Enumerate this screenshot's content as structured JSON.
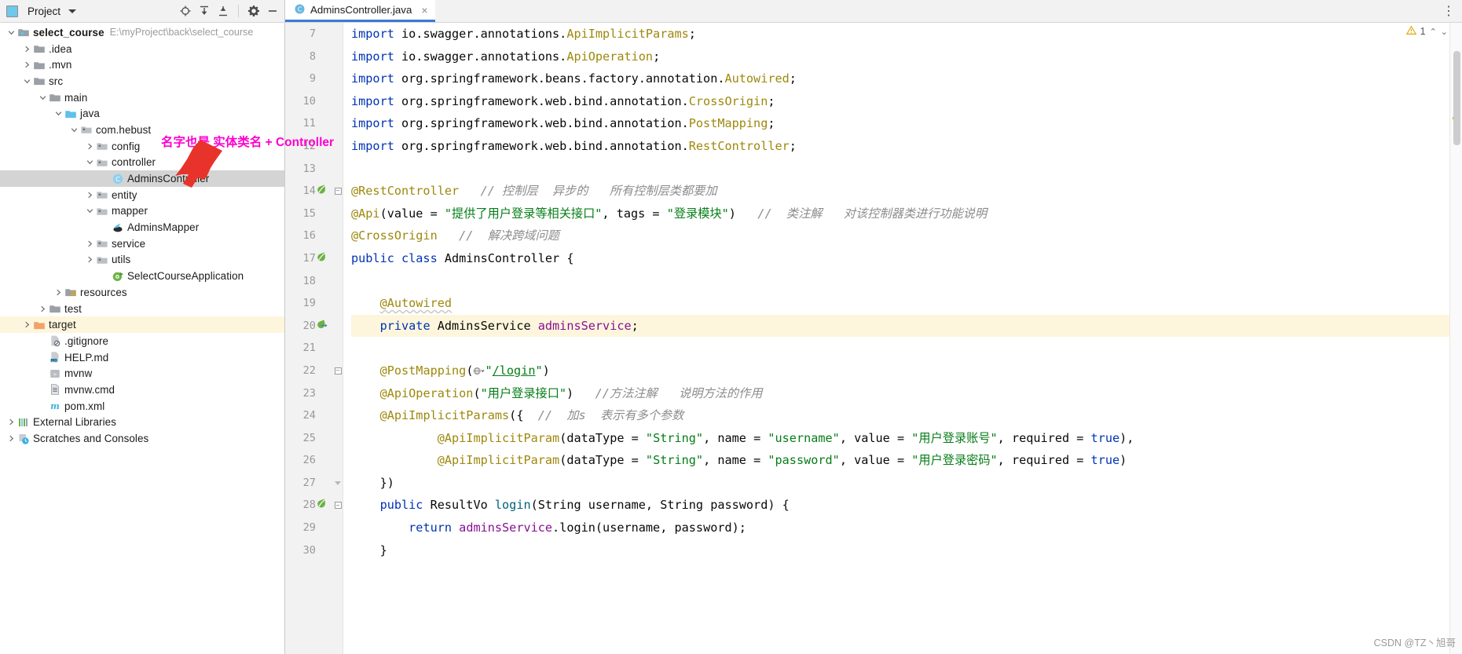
{
  "project_panel": {
    "toolbar": {
      "title": "Project",
      "icons": [
        "locate-icon",
        "expand-all-icon",
        "collapse-all-icon",
        "settings-gear-icon",
        "hide-minimize-icon"
      ]
    },
    "tree": [
      {
        "indent": 0,
        "arrow": "down",
        "icon": "module-folder-icon",
        "label": "select_course",
        "bold": true,
        "path": "E:\\myProject\\back\\select_course",
        "state": "normal"
      },
      {
        "indent": 1,
        "arrow": "right",
        "icon": "folder-icon",
        "label": ".idea",
        "state": "normal"
      },
      {
        "indent": 1,
        "arrow": "right",
        "icon": "folder-icon",
        "label": ".mvn",
        "state": "normal"
      },
      {
        "indent": 1,
        "arrow": "down",
        "icon": "folder-icon",
        "label": "src",
        "state": "normal"
      },
      {
        "indent": 2,
        "arrow": "down",
        "icon": "folder-icon",
        "label": "main",
        "state": "normal"
      },
      {
        "indent": 3,
        "arrow": "down",
        "icon": "source-folder-icon",
        "label": "java",
        "state": "normal"
      },
      {
        "indent": 4,
        "arrow": "down",
        "icon": "package-icon",
        "label": "com.hebust",
        "state": "normal"
      },
      {
        "indent": 5,
        "arrow": "right",
        "icon": "package-icon",
        "label": "config",
        "state": "normal"
      },
      {
        "indent": 5,
        "arrow": "down",
        "icon": "package-icon",
        "label": "controller",
        "state": "normal"
      },
      {
        "indent": 6,
        "arrow": "none",
        "icon": "java-class-icon",
        "label": "AdminsController",
        "state": "selected"
      },
      {
        "indent": 5,
        "arrow": "right",
        "icon": "package-icon",
        "label": "entity",
        "state": "normal"
      },
      {
        "indent": 5,
        "arrow": "down",
        "icon": "package-icon",
        "label": "mapper",
        "state": "normal"
      },
      {
        "indent": 6,
        "arrow": "none",
        "icon": "mybatis-mapper-icon",
        "label": "AdminsMapper",
        "state": "normal"
      },
      {
        "indent": 5,
        "arrow": "right",
        "icon": "package-icon",
        "label": "service",
        "state": "normal"
      },
      {
        "indent": 5,
        "arrow": "right",
        "icon": "package-icon",
        "label": "utils",
        "state": "normal"
      },
      {
        "indent": 6,
        "arrow": "none",
        "icon": "spring-boot-app-icon",
        "label": "SelectCourseApplication",
        "state": "normal"
      },
      {
        "indent": 3,
        "arrow": "right",
        "icon": "resources-folder-icon",
        "label": "resources",
        "state": "normal"
      },
      {
        "indent": 2,
        "arrow": "right",
        "icon": "folder-icon",
        "label": "test",
        "state": "normal"
      },
      {
        "indent": 1,
        "arrow": "right",
        "icon": "excluded-folder-icon",
        "label": "target",
        "state": "highlight"
      },
      {
        "indent": 2,
        "arrow": "none",
        "icon": "gitignore-file-icon",
        "label": ".gitignore",
        "state": "normal"
      },
      {
        "indent": 2,
        "arrow": "none",
        "icon": "markdown-file-icon",
        "label": "HELP.md",
        "state": "normal"
      },
      {
        "indent": 2,
        "arrow": "none",
        "icon": "shell-script-icon",
        "label": "mvnw",
        "state": "normal"
      },
      {
        "indent": 2,
        "arrow": "none",
        "icon": "cmd-file-icon",
        "label": "mvnw.cmd",
        "state": "normal"
      },
      {
        "indent": 2,
        "arrow": "none",
        "icon": "maven-file-icon",
        "label": "pom.xml",
        "state": "normal"
      },
      {
        "indent": 0,
        "arrow": "right",
        "icon": "libraries-icon",
        "label": "External Libraries",
        "state": "normal"
      },
      {
        "indent": 0,
        "arrow": "right",
        "icon": "scratches-icon",
        "label": "Scratches and Consoles",
        "state": "normal"
      }
    ]
  },
  "editor": {
    "tab": {
      "label": "AdminsController.java",
      "icon": "java-class-icon",
      "close_icon": "close-icon"
    },
    "tab_menu_icon": "more-options-icon",
    "inspection": {
      "warning_count": "1",
      "warning_icon": "warning-triangle-icon",
      "up_icon": "chevron-up-icon",
      "down_icon": "chevron-down-icon"
    },
    "lines": [
      {
        "num": "7",
        "tokens": [
          {
            "t": "kw",
            "s": "import "
          },
          {
            "t": "plain",
            "s": "io.swagger.annotations."
          },
          {
            "t": "ann",
            "s": "ApiImplicitParams"
          },
          {
            "t": "plain",
            "s": ";"
          }
        ]
      },
      {
        "num": "8",
        "tokens": [
          {
            "t": "kw",
            "s": "import "
          },
          {
            "t": "plain",
            "s": "io.swagger.annotations."
          },
          {
            "t": "ann",
            "s": "ApiOperation"
          },
          {
            "t": "plain",
            "s": ";"
          }
        ]
      },
      {
        "num": "9",
        "tokens": [
          {
            "t": "kw",
            "s": "import "
          },
          {
            "t": "plain",
            "s": "org.springframework.beans.factory.annotation."
          },
          {
            "t": "ann",
            "s": "Autowired"
          },
          {
            "t": "plain",
            "s": ";"
          }
        ]
      },
      {
        "num": "10",
        "tokens": [
          {
            "t": "kw",
            "s": "import "
          },
          {
            "t": "plain",
            "s": "org.springframework.web.bind.annotation."
          },
          {
            "t": "ann",
            "s": "CrossOrigin"
          },
          {
            "t": "plain",
            "s": ";"
          }
        ]
      },
      {
        "num": "11",
        "tokens": [
          {
            "t": "kw",
            "s": "import "
          },
          {
            "t": "plain",
            "s": "org.springframework.web.bind.annotation."
          },
          {
            "t": "ann",
            "s": "PostMapping"
          },
          {
            "t": "plain",
            "s": ";"
          }
        ]
      },
      {
        "num": "12",
        "tokens": [
          {
            "t": "kw",
            "s": "import "
          },
          {
            "t": "plain",
            "s": "org.springframework.web.bind.annotation."
          },
          {
            "t": "ann",
            "s": "RestController"
          },
          {
            "t": "plain",
            "s": ";"
          }
        ]
      },
      {
        "num": "13",
        "tokens": []
      },
      {
        "num": "14",
        "tokens": [
          {
            "t": "ann",
            "s": "@RestController"
          },
          {
            "t": "cmt",
            "s": "   // 控制层  异步的   所有控制层类都要加"
          }
        ]
      },
      {
        "num": "15",
        "tokens": [
          {
            "t": "ann",
            "s": "@Api"
          },
          {
            "t": "plain",
            "s": "(value = "
          },
          {
            "t": "str",
            "s": "\"提供了用户登录等相关接口\""
          },
          {
            "t": "plain",
            "s": ", tags = "
          },
          {
            "t": "str",
            "s": "\"登录模块\""
          },
          {
            "t": "plain",
            "s": ")"
          },
          {
            "t": "cmt",
            "s": "   //  类注解   对该控制器类进行功能说明"
          }
        ]
      },
      {
        "num": "16",
        "tokens": [
          {
            "t": "ann",
            "s": "@CrossOrigin"
          },
          {
            "t": "cmt",
            "s": "   //  解决跨域问题"
          }
        ]
      },
      {
        "num": "17",
        "tokens": [
          {
            "t": "kw",
            "s": "public class "
          },
          {
            "t": "plain",
            "s": "AdminsController {"
          }
        ]
      },
      {
        "num": "18",
        "tokens": []
      },
      {
        "num": "19",
        "tokens": [
          {
            "t": "plain",
            "s": "    "
          },
          {
            "t": "ann wavy",
            "s": "@Autowired"
          }
        ]
      },
      {
        "num": "20",
        "tokens": [
          {
            "t": "plain",
            "s": "    "
          },
          {
            "t": "kw",
            "s": "private "
          },
          {
            "t": "plain",
            "s": "AdminsService "
          },
          {
            "t": "fld",
            "s": "adminsService"
          },
          {
            "t": "plain",
            "s": ";"
          }
        ]
      },
      {
        "num": "21",
        "tokens": []
      },
      {
        "num": "22",
        "tokens": [
          {
            "t": "plain",
            "s": "    "
          },
          {
            "t": "ann",
            "s": "@PostMapping"
          },
          {
            "t": "plain",
            "s": "("
          },
          {
            "t": "icon",
            "s": "globe-chevron-icon"
          },
          {
            "t": "str",
            "s": "\""
          },
          {
            "t": "link",
            "s": "/login"
          },
          {
            "t": "str",
            "s": "\""
          },
          {
            "t": "plain",
            "s": ")"
          }
        ]
      },
      {
        "num": "23",
        "tokens": [
          {
            "t": "plain",
            "s": "    "
          },
          {
            "t": "ann",
            "s": "@ApiOperation"
          },
          {
            "t": "plain",
            "s": "("
          },
          {
            "t": "str",
            "s": "\"用户登录接口\""
          },
          {
            "t": "plain",
            "s": ")"
          },
          {
            "t": "cmt",
            "s": "   //方法注解   说明方法的作用"
          }
        ]
      },
      {
        "num": "24",
        "tokens": [
          {
            "t": "plain",
            "s": "    "
          },
          {
            "t": "ann",
            "s": "@ApiImplicitParams"
          },
          {
            "t": "plain",
            "s": "({"
          },
          {
            "t": "cmt",
            "s": "  //  加s  表示有多个参数"
          }
        ]
      },
      {
        "num": "25",
        "tokens": [
          {
            "t": "plain",
            "s": "            "
          },
          {
            "t": "ann",
            "s": "@ApiImplicitParam"
          },
          {
            "t": "plain",
            "s": "(dataType = "
          },
          {
            "t": "str",
            "s": "\"String\""
          },
          {
            "t": "plain",
            "s": ", name = "
          },
          {
            "t": "str",
            "s": "\"username\""
          },
          {
            "t": "plain",
            "s": ", value = "
          },
          {
            "t": "str",
            "s": "\"用户登录账号\""
          },
          {
            "t": "plain",
            "s": ", required = "
          },
          {
            "t": "kw",
            "s": "true"
          },
          {
            "t": "plain",
            "s": "),"
          }
        ]
      },
      {
        "num": "26",
        "tokens": [
          {
            "t": "plain",
            "s": "            "
          },
          {
            "t": "ann",
            "s": "@ApiImplicitParam"
          },
          {
            "t": "plain",
            "s": "(dataType = "
          },
          {
            "t": "str",
            "s": "\"String\""
          },
          {
            "t": "plain",
            "s": ", name = "
          },
          {
            "t": "str",
            "s": "\"password\""
          },
          {
            "t": "plain",
            "s": ", value = "
          },
          {
            "t": "str",
            "s": "\"用户登录密码\""
          },
          {
            "t": "plain",
            "s": ", required = "
          },
          {
            "t": "kw",
            "s": "true"
          },
          {
            "t": "plain",
            "s": ")"
          }
        ]
      },
      {
        "num": "27",
        "tokens": [
          {
            "t": "plain",
            "s": "    })"
          }
        ]
      },
      {
        "num": "28",
        "tokens": [
          {
            "t": "plain",
            "s": "    "
          },
          {
            "t": "kw",
            "s": "public "
          },
          {
            "t": "plain",
            "s": "ResultVo "
          },
          {
            "t": "mth",
            "s": "login"
          },
          {
            "t": "plain",
            "s": "(String username, String password) {"
          }
        ]
      },
      {
        "num": "29",
        "tokens": [
          {
            "t": "plain",
            "s": "        "
          },
          {
            "t": "kw",
            "s": "return "
          },
          {
            "t": "fld",
            "s": "adminsService"
          },
          {
            "t": "plain",
            "s": ".login(username, password);"
          }
        ]
      },
      {
        "num": "30",
        "tokens": [
          {
            "t": "plain",
            "s": "    }"
          }
        ]
      }
    ],
    "gutter_icons": [
      {
        "line": "14",
        "icon": "spring-bean-icon"
      },
      {
        "line": "17",
        "icon": "spring-bean-icon"
      },
      {
        "line": "20",
        "icon": "spring-autowired-icon"
      },
      {
        "line": "28",
        "icon": "spring-bean-icon"
      }
    ]
  },
  "annotation": {
    "text": "名字也是 实体类名 + Controller",
    "color": "#ff00d0",
    "arrow_color": "#e8332a",
    "arrow_icon": "red-arrow-icon"
  },
  "watermark": {
    "text": "CSDN @TZ丶旭哥"
  },
  "colors": {
    "accent": "#3c7bd4",
    "selection": "#d4d4d4",
    "highlight_row": "#fdf6dd",
    "keyword": "#0033b3",
    "annotation": "#9e880d",
    "string": "#067d17",
    "comment": "#8c8c8c",
    "field": "#871094",
    "method": "#00627a"
  }
}
